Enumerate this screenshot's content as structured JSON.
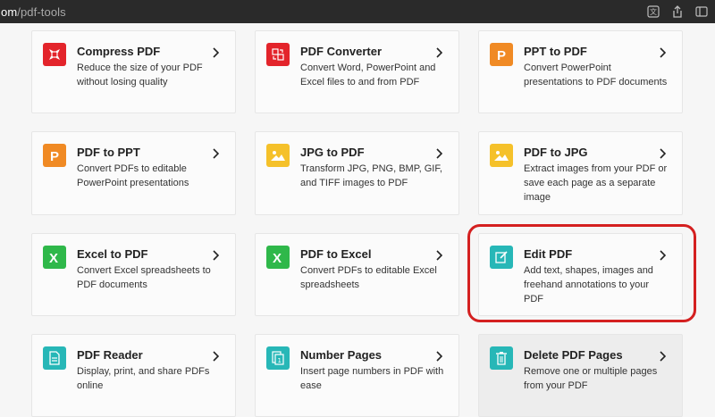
{
  "browser": {
    "url_domain": "om",
    "url_path": "/pdf-tools"
  },
  "cards": [
    {
      "title": "Compress PDF",
      "desc": "Reduce the size of your PDF without losing quality",
      "icon": "compress-icon",
      "color": "#e3242b"
    },
    {
      "title": "PDF Converter",
      "desc": "Convert Word, PowerPoint and Excel files to and from PDF",
      "icon": "converter-icon",
      "color": "#e3242b"
    },
    {
      "title": "PPT to PDF",
      "desc": "Convert PowerPoint presentations to PDF documents",
      "icon": "ppt-icon",
      "color": "#f08a24"
    },
    {
      "title": "PDF to PPT",
      "desc": "Convert PDFs to editable PowerPoint presentations",
      "icon": "ppt-icon",
      "color": "#f08a24"
    },
    {
      "title": "JPG to PDF",
      "desc": "Transform JPG, PNG, BMP, GIF, and TIFF images to PDF",
      "icon": "image-icon",
      "color": "#f5c12a"
    },
    {
      "title": "PDF to JPG",
      "desc": "Extract images from your PDF or save each page as a separate image",
      "icon": "image-icon",
      "color": "#f5c12a"
    },
    {
      "title": "Excel to PDF",
      "desc": "Convert Excel spreadsheets to PDF documents",
      "icon": "excel-icon",
      "color": "#2fb84a"
    },
    {
      "title": "PDF to Excel",
      "desc": "Convert PDFs to editable Excel spreadsheets",
      "icon": "excel-icon",
      "color": "#2fb84a"
    },
    {
      "title": "Edit PDF",
      "desc": "Add text, shapes, images and freehand annotations to your PDF",
      "icon": "edit-icon",
      "color": "#27b7b7"
    },
    {
      "title": "PDF Reader",
      "desc": "Display, print, and share PDFs online",
      "icon": "reader-icon",
      "color": "#27b7b7"
    },
    {
      "title": "Number Pages",
      "desc": "Insert page numbers in PDF with ease",
      "icon": "number-icon",
      "color": "#27b7b7"
    },
    {
      "title": "Delete PDF Pages",
      "desc": "Remove one or multiple pages from your PDF",
      "icon": "delete-icon",
      "color": "#27b7b7"
    }
  ]
}
